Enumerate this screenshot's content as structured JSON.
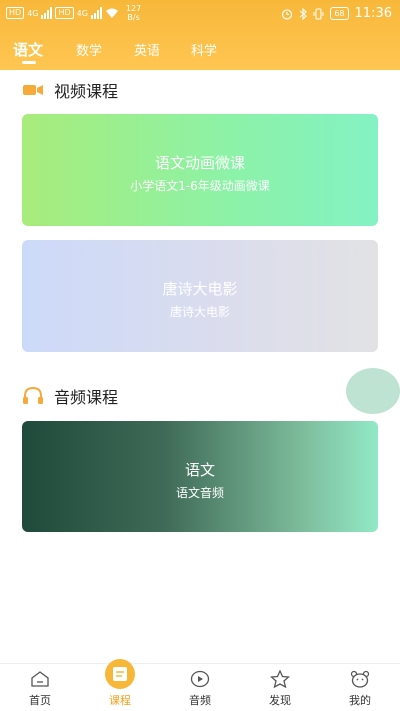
{
  "status_bar": {
    "sim1": "HD",
    "sim2": "HD",
    "net1": "4G",
    "net2": "4G",
    "speed_value": "127",
    "speed_unit": "B/s",
    "battery": "68",
    "time": "11:36"
  },
  "tabs": [
    {
      "label": "语文"
    },
    {
      "label": "数学"
    },
    {
      "label": "英语"
    },
    {
      "label": "科学"
    }
  ],
  "video_section": {
    "title": "视频课程",
    "cards": [
      {
        "title": "语文动画微课",
        "subtitle": "小学语文1-6年级动画微课"
      },
      {
        "title": "唐诗大电影",
        "subtitle": "唐诗大电影"
      }
    ]
  },
  "audio_section": {
    "title": "音频课程",
    "cards": [
      {
        "title": "语文",
        "subtitle": "语文音频"
      }
    ]
  },
  "bottom_nav": [
    {
      "label": "首页",
      "icon": "home-icon"
    },
    {
      "label": "课程",
      "icon": "course-icon"
    },
    {
      "label": "音频",
      "icon": "play-icon"
    },
    {
      "label": "发现",
      "icon": "star-icon"
    },
    {
      "label": "我的",
      "icon": "bear-icon"
    }
  ],
  "colors": {
    "accent": "#f7b83a",
    "active_nav": "#f4a11f"
  }
}
